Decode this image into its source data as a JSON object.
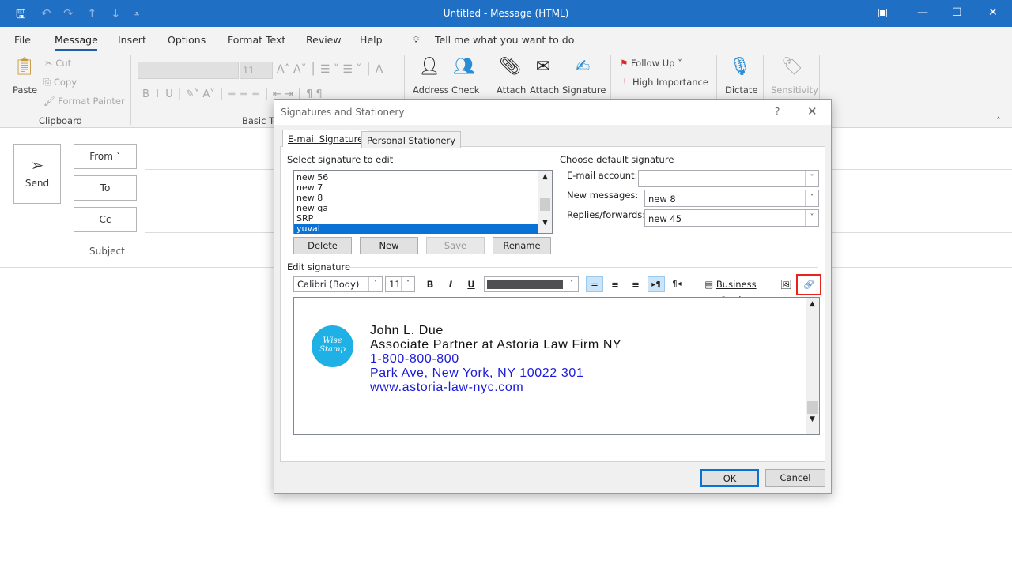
{
  "window": {
    "title": "Untitled  -  Message (HTML)"
  },
  "menu": [
    "File",
    "Message",
    "Insert",
    "Options",
    "Format Text",
    "Review",
    "Help"
  ],
  "tell_me": "Tell me what you want to do",
  "ribbon": {
    "paste": "Paste",
    "cut": "Cut",
    "copy": "Copy",
    "format_painter": "Format Painter",
    "clipboard": "Clipboard",
    "font_size": "11",
    "basic_text": "Basic Text",
    "address": "Address",
    "check": "Check",
    "attach_file": "Attach",
    "attach_item": "Attach",
    "signature": "Signature",
    "follow_up": "Follow Up",
    "high_importance": "High Importance",
    "dictate": "Dictate",
    "sensitivity": "Sensitivity"
  },
  "compose": {
    "send": "Send",
    "from": "From",
    "to": "To",
    "cc": "Cc",
    "subject": "Subject"
  },
  "dialog": {
    "title": "Signatures and Stationery",
    "help": "?",
    "tabs": [
      "E-mail Signature",
      "Personal Stationery"
    ],
    "select_label": "Select signature to edit",
    "signatures": [
      "new 56",
      "new 7",
      "new 8",
      "new qa",
      "SRP",
      "yuval"
    ],
    "selected": "yuval",
    "buttons": {
      "delete": "Delete",
      "new": "New",
      "save": "Save",
      "rename": "Rename",
      "ok": "OK",
      "cancel": "Cancel"
    },
    "default_label": "Choose default signature",
    "email_account_label": "E-mail account:",
    "email_account": "",
    "new_messages_label": "New messages:",
    "new_messages": "new 8",
    "replies_label": "Replies/forwards:",
    "replies": "new 45",
    "edit_label": "Edit signature",
    "font": "Calibri (Body)",
    "size": "11",
    "business_card": "Business Card",
    "signature": {
      "logo": "Wise Stamp",
      "name": "John L. Due",
      "title": "Associate Partner at Astoria Law Firm NY",
      "phone": "1-800-800-800",
      "address": "Park Ave, New York, NY 10022 301",
      "website": "www.astoria-law-nyc.com"
    },
    "highlight_color": "#e8231b"
  }
}
